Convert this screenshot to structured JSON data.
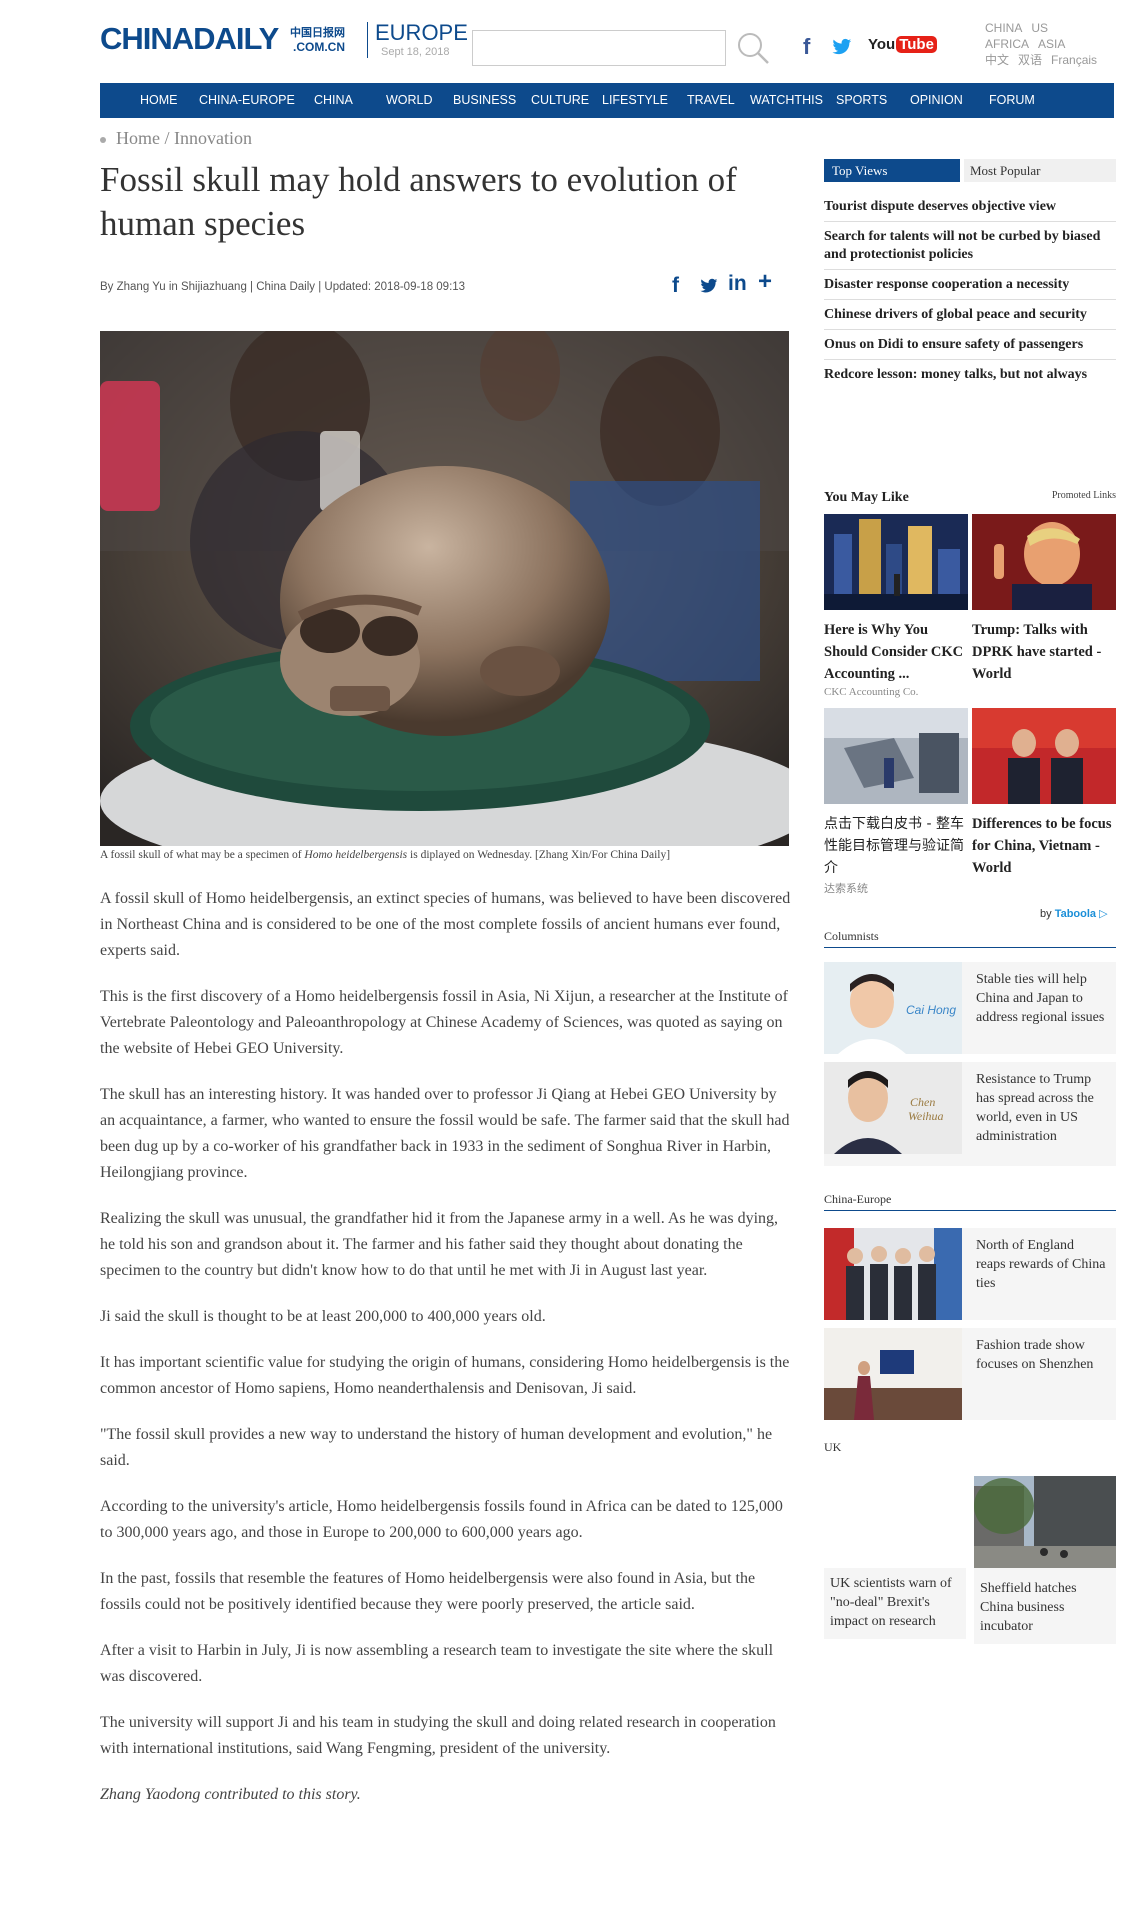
{
  "header": {
    "logo_main": "CHINADAILY",
    "logo_cn": "中国日报网",
    "logo_domain": ".COM.CN",
    "edition": "EUROPE",
    "date": "Sept 18, 2018",
    "search_placeholder": "",
    "editions_row1": [
      "CHINA",
      "US"
    ],
    "editions_row2": [
      "AFRICA",
      "ASIA"
    ],
    "editions_row3": [
      "中文",
      "双语",
      "Français"
    ],
    "social": {
      "facebook": "f",
      "youtube_you": "You",
      "youtube_tube": "Tube"
    }
  },
  "nav": {
    "items": [
      "HOME",
      "CHINA-EUROPE",
      "CHINA",
      "WORLD",
      "BUSINESS",
      "CULTURE",
      "LIFESTYLE",
      "TRAVEL",
      "WATCHTHIS",
      "SPORTS",
      "OPINION",
      "FORUM"
    ]
  },
  "breadcrumb": {
    "home": "Home",
    "sep": " / ",
    "section": "Innovation"
  },
  "article": {
    "title": "Fossil skull may hold answers to evolution of human species",
    "byline": "By Zhang Yu in Shijiazhuang | China Daily | Updated: 2018-09-18 09:13",
    "share": {
      "fb": "f",
      "in": "in",
      "more": "+"
    },
    "caption_pre": "A fossil skull of what may be a specimen of ",
    "caption_italic": "Homo heidelbergensis",
    "caption_post": " is diplayed on Wednesday. [Zhang Xin/For China Daily]",
    "paragraphs": [
      "A fossil skull of Homo heidelbergensis, an extinct species of humans, was believed to have been discovered in Northeast China and is considered to be one of the most complete fossils of ancient humans ever found, experts said.",
      "This is the first discovery of a Homo heidelbergensis fossil in Asia, Ni Xijun, a researcher at the Institute of Vertebrate Paleontology and Paleoanthropology at Chinese Academy of Sciences, was quoted as saying on the website of Hebei GEO University.",
      "The skull has an interesting history. It was handed over to professor Ji Qiang at Hebei GEO University by an acquaintance, a farmer, who wanted to ensure the fossil would be safe. The farmer said that the skull had been dug up by a co-worker of his grandfather back in 1933 in the sediment of Songhua River in Harbin, Heilongjiang province.",
      "Realizing the skull was unusual, the grandfather hid it from the Japanese army in a well. As he was dying, he told his son and grandson about it. The farmer and his father said they thought about donating the specimen to the country but didn't know how to do that until he met with Ji in August last year.",
      "Ji said the skull is thought to be at least 200,000 to 400,000 years old.",
      "It has important scientific value for studying the origin of humans, considering Homo heidelbergensis is the common ancestor of Homo sapiens, Homo neanderthalensis and Denisovan, Ji said.",
      "\"The fossil skull provides a new way to understand the history of human development and evolution,\" he said.",
      "According to the university's article, Homo heidelbergensis fossils found in Africa can be dated to 125,000 to 300,000 years ago, and those in Europe to 200,000 to 600,000 years ago.",
      "In the past, fossils that resemble the features of Homo heidelbergensis were also found in Asia, but the fossils could not be positively identified because they were poorly preserved, the article said.",
      "After a visit to Harbin in July, Ji is now assembling a research team to investigate the site where the skull was discovered.",
      "The university will support Ji and his team in studying the skull and doing related research in cooperation with international institutions, said Wang Fengming, president of the university."
    ],
    "credit": "Zhang Yaodong contributed to this story."
  },
  "sidebar": {
    "tabs": {
      "top": "Top Views",
      "popular": "Most Popular"
    },
    "top_views": [
      "Tourist dispute deserves objective view",
      "Search for talents will not be curbed by biased and protectionist policies",
      "Disaster response cooperation a necessity",
      "Chinese drivers of global peace and security",
      "Onus on Didi to ensure safety of passengers",
      "Redcore lesson: money talks, but not always"
    ],
    "you_may_like": "You May Like",
    "promoted": "Promoted Links",
    "promos": [
      {
        "title": "Here is Why You Should Consider CKC Accounting ...",
        "source": "CKC Accounting Co."
      },
      {
        "title": "Trump: Talks with DPRK have started - World",
        "source": ""
      },
      {
        "title": "点击下载白皮书 - 整车性能目标管理与验证简介",
        "source": "达索系统"
      },
      {
        "title": "Differences to be focus for China, Vietnam - World",
        "source": ""
      }
    ],
    "taboola_by": "by ",
    "taboola": "Taboola",
    "columnists_head": "Columnists",
    "columnists": [
      {
        "name_tag": "Cai Hong",
        "text": "Stable ties will help China and Japan to address regional issues"
      },
      {
        "name_tag1": "Chen",
        "name_tag2": "Weihua",
        "text": "Resistance to Trump has spread across the world, even in US administration"
      }
    ],
    "china_europe_head": "China-Europe",
    "china_europe": [
      {
        "text": "North of England reaps rewards of China ties"
      },
      {
        "text": "Fashion trade show focuses on Shenzhen"
      }
    ],
    "uk_head": "UK",
    "uk": [
      {
        "text": "UK scientists warn of \"no-deal\" Brexit's impact on research"
      },
      {
        "text": "Sheffield hatches China business incubator"
      }
    ]
  }
}
